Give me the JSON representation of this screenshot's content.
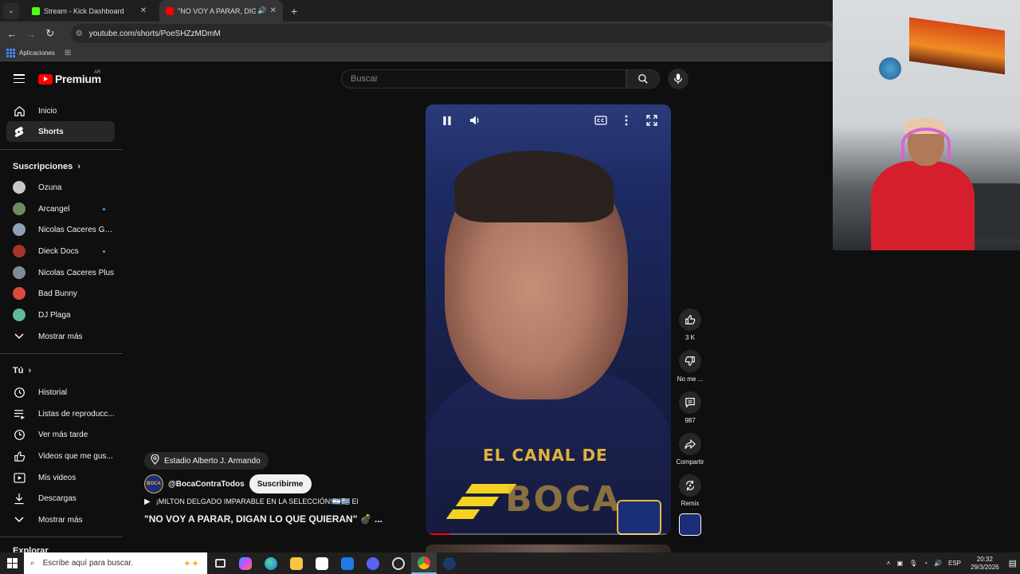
{
  "browser": {
    "tabs": [
      {
        "title": "Stream - Kick Dashboard",
        "favicon_color": "#53fc18",
        "active": false
      },
      {
        "title": "\"NO VOY A PARAR, DIGAN",
        "favicon_color": "#ff0000",
        "active": true
      }
    ],
    "url": "youtube.com/shorts/PoeSHZzMDmM",
    "bookmarks": [
      {
        "label": "Aplicaciones"
      }
    ]
  },
  "youtube": {
    "logo_text": "Premium",
    "country_code": "AR",
    "search_placeholder": "Buscar",
    "sidebar": {
      "main": [
        {
          "label": "Inicio",
          "icon": "home-icon"
        },
        {
          "label": "Shorts",
          "icon": "shorts-icon",
          "active": true
        }
      ],
      "subscriptions_header": "Suscripciones",
      "subscriptions": [
        {
          "label": "Ozuna",
          "color": "#c9c9c9",
          "new": false
        },
        {
          "label": "Arcangel",
          "color": "#6f8a5e",
          "new": true
        },
        {
          "label": "Nicolas Caceres Ga...",
          "color": "#8fa0b8",
          "new": false
        },
        {
          "label": "Dieck Docs",
          "color": "#a3352d",
          "new": true
        },
        {
          "label": "Nicolas Caceres Plus",
          "color": "#7e8b99",
          "new": false
        },
        {
          "label": "Bad Bunny",
          "color": "#d94a3a",
          "new": false
        },
        {
          "label": "DJ Plaga",
          "color": "#5fb8a0",
          "new": false
        }
      ],
      "show_more_1": "Mostrar más",
      "you_header": "Tú",
      "you_items": [
        {
          "label": "Historial",
          "icon": "history-icon"
        },
        {
          "label": "Listas de reproducc...",
          "icon": "playlist-icon"
        },
        {
          "label": "Ver más tarde",
          "icon": "watch-later-icon"
        },
        {
          "label": "Videos que me gus...",
          "icon": "liked-videos-icon"
        },
        {
          "label": "Mis videos",
          "icon": "my-videos-icon"
        },
        {
          "label": "Descargas",
          "icon": "downloads-icon"
        }
      ],
      "show_more_2": "Mostrar más",
      "explore_header": "Explorar"
    },
    "short": {
      "watermark_line1": "EL CANAL DE",
      "watermark_line2": "BOCA",
      "location": "Estadio Alberto J. Armando",
      "channel": "@BocaContraTodos",
      "subscribe_label": "Suscribirme",
      "music": "¡MILTON DELGADO IMPARABLE EN LA SELECCIÓN!🇦🇷🇺🇾 El",
      "title": "\"NO VOY A PARAR, DIGAN LO QUE QUIERAN\" 💣 ...",
      "progress": 0.1
    },
    "actions": [
      {
        "label": "3 K",
        "icon": "like-icon"
      },
      {
        "label": "No me ...",
        "icon": "dislike-icon"
      },
      {
        "label": "987",
        "icon": "comment-icon"
      },
      {
        "label": "Compartir",
        "icon": "share-icon"
      },
      {
        "label": "Remix",
        "icon": "remix-icon"
      }
    ]
  },
  "taskbar": {
    "search_placeholder": "Escribe aquí para buscar.",
    "language": "ESP",
    "time": "20:32",
    "date": "29/3/2026"
  }
}
